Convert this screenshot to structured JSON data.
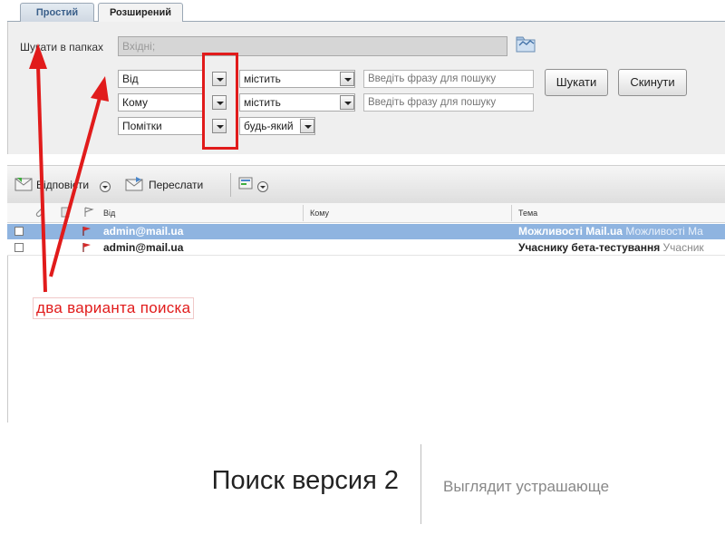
{
  "tabs": {
    "simple": "Простий",
    "advanced": "Розширений"
  },
  "search": {
    "folders_label": "Шукати в папках",
    "folders_value": "Вхідні;",
    "rows": [
      {
        "field": "Від",
        "condition": "містить",
        "placeholder": "Введіть фразу для пошуку"
      },
      {
        "field": "Кому",
        "condition": "містить",
        "placeholder": "Введіть фразу для пошуку"
      },
      {
        "field": "Помітки",
        "condition": "будь-який"
      }
    ],
    "search_button": "Шукати",
    "reset_button": "Скинути"
  },
  "toolbar": {
    "reply": "Відповісти",
    "forward": "Переслати"
  },
  "list": {
    "columns": {
      "from": "Від",
      "to": "Кому",
      "subject": "Тема"
    },
    "rows": [
      {
        "from": "admin@mail.ua",
        "subject": "Можливості Mail.ua",
        "preview": "Можливості Ma"
      },
      {
        "from": "admin@mail.ua",
        "subject": "Учаснику бета-тестування",
        "preview": "Учасник"
      }
    ]
  },
  "annotation": {
    "label": "два варианта поиска",
    "color": "#e11b1b"
  },
  "caption": {
    "title": "Поиск версия 2",
    "subtitle": "Выглядит устрашающе"
  }
}
